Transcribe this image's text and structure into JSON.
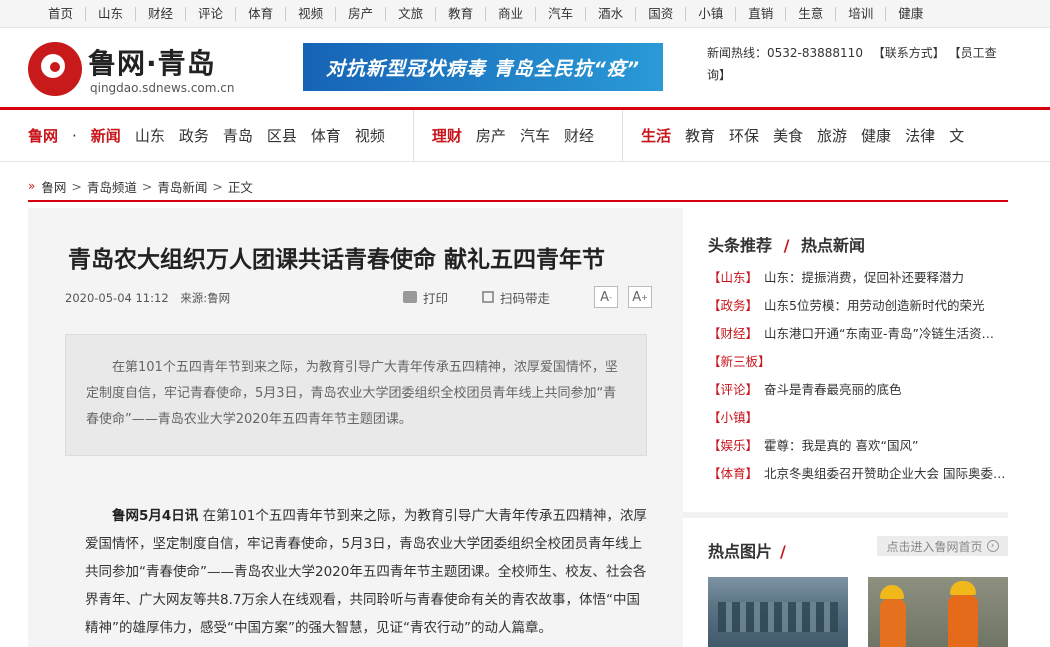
{
  "topnav": [
    "首页",
    "山东",
    "财经",
    "评论",
    "体育",
    "视频",
    "房产",
    "文旅",
    "教育",
    "商业",
    "汽车",
    "酒水",
    "国资",
    "小镇",
    "直销",
    "生意",
    "培训",
    "健康"
  ],
  "logo": {
    "name": "鲁网·青岛",
    "domain": "qingdao.sdnews.com.cn"
  },
  "banner": {
    "text": "对抗新型冠状病毒 青岛全民抗“疫”"
  },
  "hotline": {
    "label": "新闻热线：0532-83888110",
    "contact": "【联系方式】",
    "staff": "【员工查询】"
  },
  "mainnav": {
    "group1": [
      {
        "label": "鲁网",
        "hl": true
      },
      {
        "label": "·",
        "dot": true
      },
      {
        "label": "新闻",
        "hl": true
      },
      {
        "label": "山东"
      },
      {
        "label": "政务"
      },
      {
        "label": "青岛"
      },
      {
        "label": "区县"
      },
      {
        "label": "体育"
      },
      {
        "label": "视频"
      }
    ],
    "group2": [
      {
        "label": "理财",
        "hl": true
      },
      {
        "label": "房产"
      },
      {
        "label": "汽车"
      },
      {
        "label": "财经"
      }
    ],
    "group3": [
      {
        "label": "生活",
        "hl": true
      },
      {
        "label": "教育"
      },
      {
        "label": "环保"
      },
      {
        "label": "美食"
      },
      {
        "label": "旅游"
      },
      {
        "label": "健康"
      },
      {
        "label": "法律"
      },
      {
        "label": "文"
      }
    ]
  },
  "breadcrumb": [
    "鲁网",
    "青岛频道",
    "青岛新闻",
    "正文"
  ],
  "article": {
    "title": "青岛农大组织万人团课共话青春使命 献礼五四青年节",
    "date": "2020-05-04 11:12",
    "source": "来源:鲁网",
    "print": "打印",
    "scan": "扫码带走",
    "font_small": "A",
    "font_large": "A",
    "summary": "在第101个五四青年节到来之际，为教育引导广大青年传承五四精神，浓厚爱国情怀，坚定制度自信，牢记青春使命，5月3日，青岛农业大学团委组织全校团员青年线上共同参加“青春使命”——青岛农业大学2020年五四青年节主题团课。",
    "lead": "鲁网5月4日讯",
    "body": "在第101个五四青年节到来之际，为教育引导广大青年传承五四精神，浓厚爱国情怀，坚定制度自信，牢记青春使命，5月3日，青岛农业大学团委组织全校团员青年线上共同参加“青春使命”——青岛农业大学2020年五四青年节主题团课。全校师生、校友、社会各界青年、广大网友等共8.7万余人在线观看，共同聆听与青春使命有关的青农故事，体悟“中国精神”的雄厚伟力，感受“中国方案”的强大智慧，见证“青农行动”的动人篇章。"
  },
  "side": {
    "title_a": "头条推荐",
    "slash": "/",
    "title_b": "热点新闻",
    "news": [
      {
        "tag": "【山东】",
        "text": "山东：提振消费，促回补还要释潜力"
      },
      {
        "tag": "【政务】",
        "text": "山东5位劳模：用劳动创造新时代的荣光"
      },
      {
        "tag": "【财经】",
        "text": "山东港口开通“东南亚-青岛”冷链生活资…"
      },
      {
        "tag": "【新三板】",
        "text": ""
      },
      {
        "tag": "【评论】",
        "text": "奋斗是青春最亮丽的底色"
      },
      {
        "tag": "【小镇】",
        "text": ""
      },
      {
        "tag": "【娱乐】",
        "text": "霍尊：我是真的 喜欢“国风”"
      },
      {
        "tag": "【体育】",
        "text": "北京冬奥组委召开赞助企业大会 国际奥委…"
      }
    ],
    "pic_title": "热点图片",
    "more": "点击进入鲁网首页"
  }
}
